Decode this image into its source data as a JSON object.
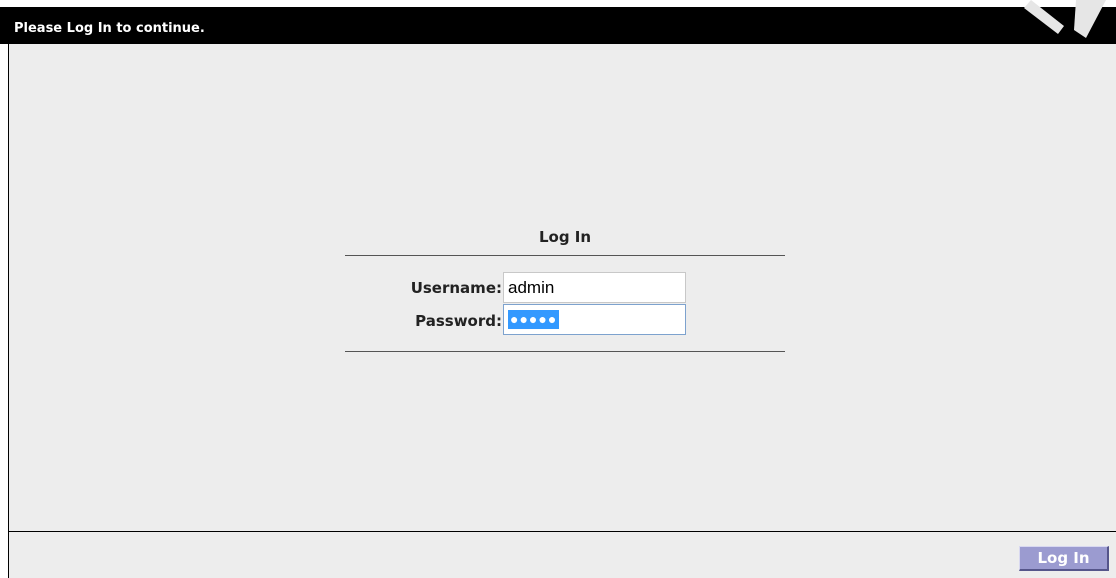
{
  "header": {
    "message": "Please Log In to continue."
  },
  "login": {
    "heading": "Log In",
    "username_label": "Username:",
    "username_value": "admin",
    "password_label": "Password:",
    "password_masked": "●●●●●"
  },
  "footer": {
    "submit_label": "Log In"
  },
  "colors": {
    "title_bar": "#000000",
    "panel_background": "#ededed",
    "button_background": "#9b9bd0",
    "selection_highlight": "#3399ff"
  }
}
